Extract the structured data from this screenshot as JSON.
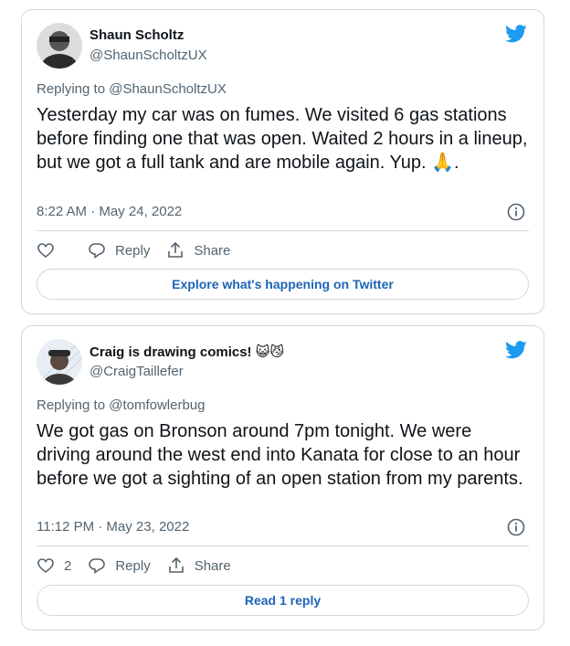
{
  "colors": {
    "twitter_blue": "#1d9bf0",
    "link_blue": "#1d64b8",
    "muted": "#536471",
    "border": "#cfd9de"
  },
  "tweets": [
    {
      "name": "Shaun Scholtz",
      "handle": "@ShaunScholtzUX",
      "replying": "Replying to @ShaunScholtzUX",
      "text": "Yesterday my car was on fumes. We visited 6 gas stations before finding one that was open. Waited 2 hours in a lineup, but we got a full tank and are mobile again. Yup. 🙏.",
      "time": "8:22 AM · May 24, 2022",
      "like_count": "",
      "reply_label": "Reply",
      "share_label": "Share",
      "cta_label": "Explore what's happening on Twitter"
    },
    {
      "name": "Craig is drawing comics! 😺😼",
      "handle": "@CraigTaillefer",
      "replying": "Replying to @tomfowlerbug",
      "text": "We got gas on Bronson around 7pm tonight. We were driving around the west end into Kanata for close to an hour before we got a sighting of an open station from my parents.",
      "time": "11:12 PM · May 23, 2022",
      "like_count": "2",
      "reply_label": "Reply",
      "share_label": "Share",
      "cta_label": "Read 1 reply"
    }
  ]
}
